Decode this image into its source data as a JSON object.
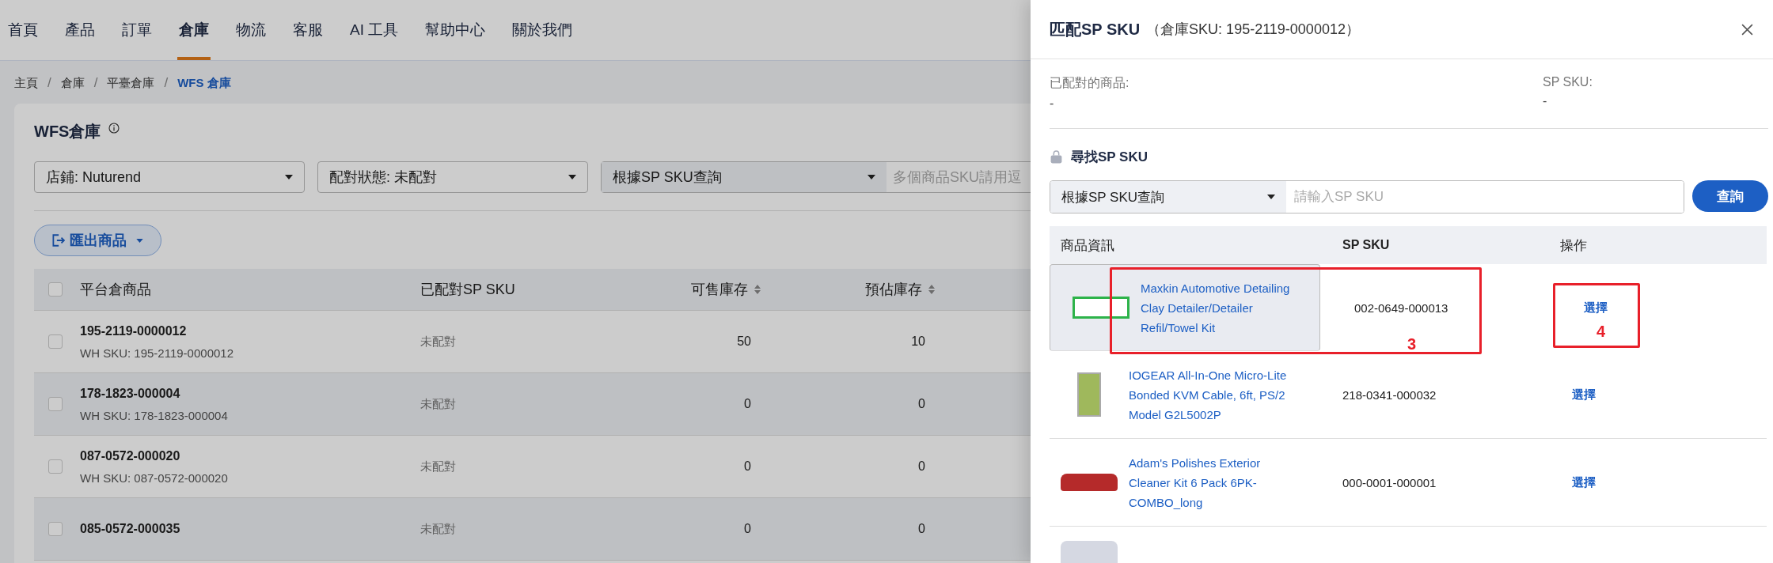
{
  "nav": [
    {
      "label": "首頁",
      "selected": false
    },
    {
      "label": "產品",
      "selected": false
    },
    {
      "label": "訂單",
      "selected": false
    },
    {
      "label": "倉庫",
      "selected": true
    },
    {
      "label": "物流",
      "selected": false
    },
    {
      "label": "客服",
      "selected": false
    },
    {
      "label": "AI 工具",
      "selected": false
    },
    {
      "label": "幫助中心",
      "selected": false
    },
    {
      "label": "關於我們",
      "selected": false
    }
  ],
  "breadcrumb": [
    {
      "label": "主頁",
      "current": false
    },
    {
      "label": "倉庫",
      "current": false,
      "sep": "/"
    },
    {
      "label": "平臺倉庫",
      "current": false,
      "sep": "/"
    },
    {
      "label": "WFS 倉庫",
      "current": true,
      "sep": "/"
    }
  ],
  "page": {
    "title": "WFS倉庫",
    "filters": [
      {
        "kind": "select",
        "value": "店鋪: Nuturend"
      },
      {
        "kind": "select",
        "value": "配對狀態: 未配對"
      },
      {
        "kind": "combo",
        "value": "根據SP SKU查詢",
        "placeholder": "多個商品SKU請用逗"
      }
    ],
    "export_button": "匯出商品",
    "select_all_checked": false,
    "columns": [
      {
        "label": "平台倉商品",
        "sortable": false
      },
      {
        "label": "已配對SP SKU",
        "sortable": false
      },
      {
        "label": "可售庫存",
        "sortable": true
      },
      {
        "label": "預佔庫存",
        "sortable": true
      }
    ],
    "rows": [
      {
        "sku": "195-2119-0000012",
        "wh_sku": "WH SKU: 195-2119-0000012",
        "matched": "未配對",
        "available": "50",
        "reserved": "10",
        "checked": false
      },
      {
        "sku": "178-1823-000004",
        "wh_sku": "WH SKU: 178-1823-000004",
        "matched": "未配對",
        "available": "0",
        "reserved": "0",
        "checked": false
      },
      {
        "sku": "087-0572-000020",
        "wh_sku": "WH SKU: 087-0572-000020",
        "matched": "未配對",
        "available": "0",
        "reserved": "0",
        "checked": false
      },
      {
        "sku": "085-0572-000035",
        "matched": "未配對",
        "available": "0",
        "reserved": "0",
        "checked": false
      }
    ]
  },
  "drawer": {
    "title": "匹配SP SKU",
    "subtitle": "（倉庫SKU: 195-2119-0000012）",
    "matched": [
      {
        "label": "已配對的商品:",
        "value": "-"
      },
      {
        "label": "SP SKU:",
        "value": "-"
      }
    ],
    "search_title": "尋找SP SKU",
    "search_select": "根據SP SKU查詢",
    "search_placeholder": "請輸入SP SKU",
    "search_button": "查詢",
    "columns": [
      "商品資訊",
      "SP SKU",
      "操作"
    ],
    "results": [
      {
        "kind": "label",
        "name": "Maxkin Automotive Detailing Clay Detailer/Detailer Refil/Towel Kit",
        "sp_sku": "002-0649-000013",
        "action": "選擇",
        "selected": true
      },
      {
        "kind": "package",
        "name": "IOGEAR All-In-One Micro-Lite Bonded KVM Cable, 6ft, PS/2 Model G2L5002P",
        "sp_sku": "218-0341-000032",
        "action": "選擇",
        "selected": false
      },
      {
        "kind": "bumper",
        "name": "Adam's Polishes Exterior Cleaner Kit 6 Pack 6PK-COMBO_long",
        "sp_sku": "000-0001-000001",
        "action": "選擇",
        "selected": false
      },
      {
        "kind": "blank",
        "selected": false
      }
    ],
    "annotations": [
      {
        "label": "3"
      },
      {
        "label": "4"
      }
    ]
  }
}
